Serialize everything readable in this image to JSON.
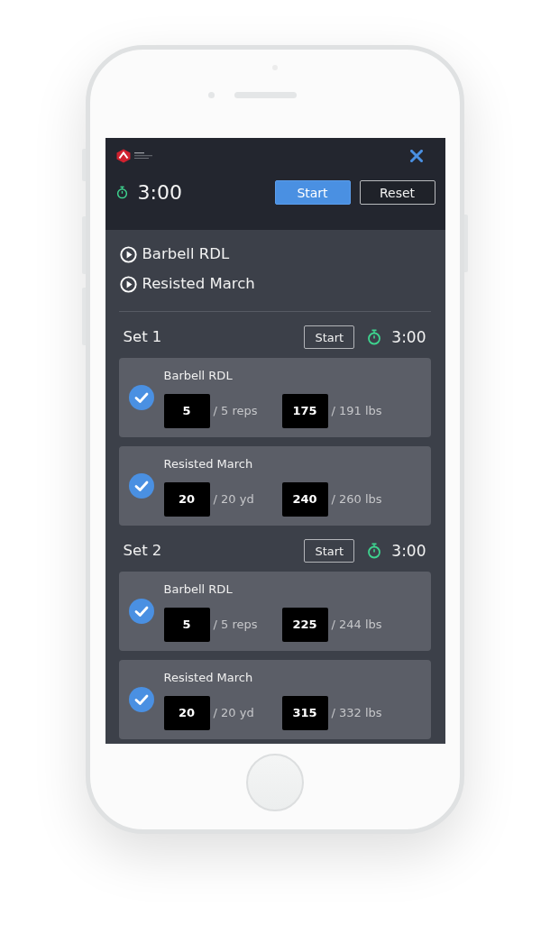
{
  "header": {
    "timer": "3:00",
    "buttons": [
      {
        "label": "Start",
        "kind": "primary"
      },
      {
        "label": "Reset",
        "kind": "outline"
      }
    ]
  },
  "exercises": [
    {
      "name": "Barbell RDL"
    },
    {
      "name": "Resisted March"
    }
  ],
  "sets": [
    {
      "title": "Set 1",
      "button": "Start",
      "timer": "3:00",
      "entries": [
        {
          "name": "Barbell RDL",
          "checked": true,
          "amount": "5",
          "amount_target": "/ 5 reps",
          "weight": "175",
          "weight_target": "/ 191 lbs"
        },
        {
          "name": "Resisted March",
          "checked": true,
          "amount": "20",
          "amount_target": "/ 20 yd",
          "weight": "240",
          "weight_target": "/ 260 lbs"
        }
      ]
    },
    {
      "title": "Set 2",
      "button": "Start",
      "timer": "3:00",
      "entries": [
        {
          "name": "Barbell RDL",
          "checked": true,
          "amount": "5",
          "amount_target": "/ 5 reps",
          "weight": "225",
          "weight_target": "/ 244 lbs"
        },
        {
          "name": "Resisted March",
          "checked": true,
          "amount": "20",
          "amount_target": "/ 20 yd",
          "weight": "315",
          "weight_target": "/ 332 lbs"
        }
      ]
    }
  ]
}
